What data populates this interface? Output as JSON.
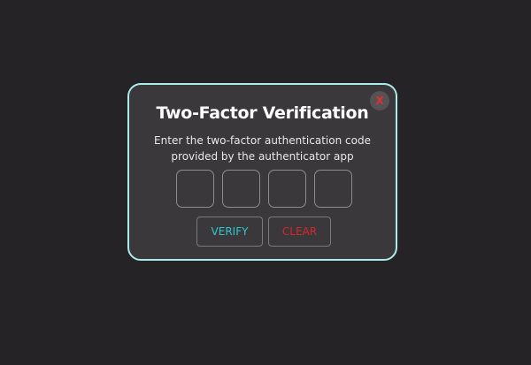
{
  "modal": {
    "title": "Two-Factor Verification",
    "description_line1": "Enter the two-factor authentication code",
    "description_line2": "provided by the authenticator app",
    "close_label": "X",
    "code_inputs": [
      "",
      "",
      "",
      ""
    ],
    "verify_label": "VERIFY",
    "clear_label": "CLEAR"
  },
  "colors": {
    "background": "#252325",
    "modal_background": "#3a383b",
    "modal_border": "#a9ecea",
    "verify_text": "#32c6cf",
    "clear_text": "#d8262b",
    "close_text": "#e0312f"
  }
}
